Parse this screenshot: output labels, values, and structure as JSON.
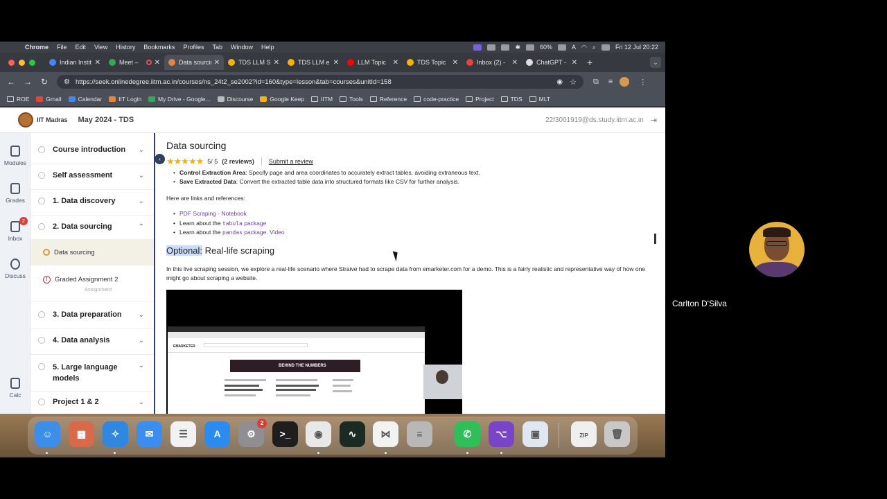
{
  "menubar": {
    "app": "Chrome",
    "items": [
      "File",
      "Edit",
      "View",
      "History",
      "Bookmarks",
      "Profiles",
      "Tab",
      "Window",
      "Help"
    ],
    "battery": "60%",
    "input_source": "A",
    "datetime": "Fri 12 Jul  20:22"
  },
  "tabs": [
    {
      "label": "Indian Instit",
      "icon": "globe-icon",
      "color": "#4285f4",
      "active": false
    },
    {
      "label": "Meet – ",
      "icon": "meet-icon",
      "color": "#34a853",
      "active": false,
      "recording": true
    },
    {
      "label": "Data sourcin",
      "icon": "iitm-icon",
      "color": "#e8833a",
      "active": true
    },
    {
      "label": "TDS LLM S",
      "icon": "tds-icon",
      "color": "#f4b400",
      "active": false
    },
    {
      "label": "TDS LLM e",
      "icon": "tds-icon",
      "color": "#f4b400",
      "active": false
    },
    {
      "label": "LLM Topic",
      "icon": "youtube-icon",
      "color": "#ff0000",
      "active": false
    },
    {
      "label": "TDS Topic",
      "icon": "tds-icon",
      "color": "#f4b400",
      "active": false
    },
    {
      "label": "Inbox (2) - ",
      "icon": "gmail-icon",
      "color": "#ea4335",
      "active": false
    },
    {
      "label": "ChatGPT - ",
      "icon": "chatgpt-icon",
      "color": "#dddddd",
      "active": false
    }
  ],
  "address": {
    "url": "https://seek.onlinedegree.iitm.ac.in/courses/ns_24t2_se2002?id=160&type=lesson&tab=courses&unitId=158"
  },
  "bookmarks": [
    {
      "label": "ROE",
      "type": "folder"
    },
    {
      "label": "Gmail",
      "type": "site",
      "color": "#ea4335"
    },
    {
      "label": "Calendar",
      "type": "site",
      "color": "#4285f4"
    },
    {
      "label": "IIT Login",
      "type": "site",
      "color": "#e8833a"
    },
    {
      "label": "My Drive - Google...",
      "type": "site",
      "color": "#34a853"
    },
    {
      "label": "Discourse",
      "type": "site",
      "color": "#bbbbbb"
    },
    {
      "label": "Google Keep",
      "type": "site",
      "color": "#f4b400"
    },
    {
      "label": "IITM",
      "type": "folder"
    },
    {
      "label": "Tools",
      "type": "folder"
    },
    {
      "label": "Reference",
      "type": "folder"
    },
    {
      "label": "code-practice",
      "type": "folder"
    },
    {
      "label": "Project",
      "type": "folder"
    },
    {
      "label": "TDS",
      "type": "folder"
    },
    {
      "label": "MLT",
      "type": "folder"
    }
  ],
  "header": {
    "logo_text": "IIT Madras",
    "course_title": "May 2024 - TDS",
    "email": "22f3001919@ds.study.iitm.ac.in"
  },
  "rail": [
    {
      "label": "Modules",
      "icon": "modules-icon"
    },
    {
      "label": "Grades",
      "icon": "grades-icon"
    },
    {
      "label": "Inbox",
      "icon": "inbox-icon",
      "badge": "2"
    },
    {
      "label": "Discuss",
      "icon": "discuss-icon"
    },
    {
      "label": "Calc",
      "icon": "calculator-icon"
    }
  ],
  "modules": [
    {
      "label": "Course introduction"
    },
    {
      "label": "Self assessment"
    },
    {
      "label": "1. Data discovery"
    },
    {
      "label": "2. Data sourcing",
      "expanded": true
    },
    {
      "label": "3. Data preparation"
    },
    {
      "label": "4. Data analysis"
    },
    {
      "label": "5. Large language models"
    },
    {
      "label": "Project 1 & 2"
    }
  ],
  "submodules": [
    {
      "label": "Data sourcing",
      "active": true
    },
    {
      "label": "Graded Assignment 2",
      "note": "Assignment"
    }
  ],
  "lesson": {
    "title": "Data sourcing",
    "stars": "★★★★★",
    "rating": "5/ 5",
    "reviews": "(2 reviews)",
    "submit_review": "Submit a review",
    "bullets_top": [
      {
        "bold": "Control Extraction Area",
        "text": ": Specify page and area coordinates to accurately extract tables, avoiding extraneous text."
      },
      {
        "bold": "Save Extracted Data",
        "text": ": Convert the extracted table data into structured formats like CSV for further analysis."
      }
    ],
    "links_intro": "Here are links and references:",
    "link1": "PDF Scraping - Notebook",
    "link2_pre": "Learn about the ",
    "link2_code": "tabula",
    "link2_post": " package",
    "link3_pre": "Learn about the ",
    "link3_code": "pandas",
    "link3_post": " package. ",
    "link3_video": "Video",
    "optional_label": "Optional:",
    "optional_title": " Real-life scraping",
    "optional_desc": "In this live scraping session, we explore a real-life scenario where Straive had to scrape data from emarketer.com for a demo. This is a fairly realistic and representative way of how one might go about scraping a website.",
    "video_site": "EMARKETER",
    "video_banner": "BEHIND THE NUMBERS"
  },
  "dock": [
    {
      "name": "finder-icon",
      "color": "#3b8fe8",
      "glyph": "☺"
    },
    {
      "name": "launchpad-icon",
      "color": "#d86a4a",
      "glyph": "▦"
    },
    {
      "name": "safari-icon",
      "color": "#2e88e0",
      "glyph": "✧"
    },
    {
      "name": "mail-icon",
      "color": "#3a8ef0",
      "glyph": "✉"
    },
    {
      "name": "reminders-icon",
      "color": "#f2f2f2",
      "glyph": "☰"
    },
    {
      "name": "app-store-icon",
      "color": "#2a8cf0",
      "glyph": "A"
    },
    {
      "name": "system-settings-icon",
      "color": "#8e8e93",
      "glyph": "⚙",
      "badge": "2"
    },
    {
      "name": "terminal-icon",
      "color": "#1e1e1e",
      "glyph": ">_"
    },
    {
      "name": "chrome-icon",
      "color": "#e8e8e8",
      "glyph": "◉"
    },
    {
      "name": "activity-monitor-icon",
      "color": "#1c2a24",
      "glyph": "∿"
    },
    {
      "name": "vscode-icon",
      "color": "#f2f2f2",
      "glyph": "⋈"
    },
    {
      "name": "database-icon",
      "color": "#b8b8b8",
      "glyph": "≡"
    },
    {
      "name": "whatsapp-icon",
      "color": "#2fbf58",
      "glyph": "✆"
    },
    {
      "name": "github-desktop-icon",
      "color": "#7a44c8",
      "glyph": "⌥"
    },
    {
      "name": "preview-icon",
      "color": "#dfe8f0",
      "glyph": "▣"
    },
    {
      "name": "zip-file-icon",
      "color": "#efefef",
      "glyph": "ZIP"
    },
    {
      "name": "trash-icon",
      "color": "#c8c8c8",
      "glyph": "🗑"
    }
  ],
  "participant": {
    "name": "Carlton D'Silva"
  }
}
